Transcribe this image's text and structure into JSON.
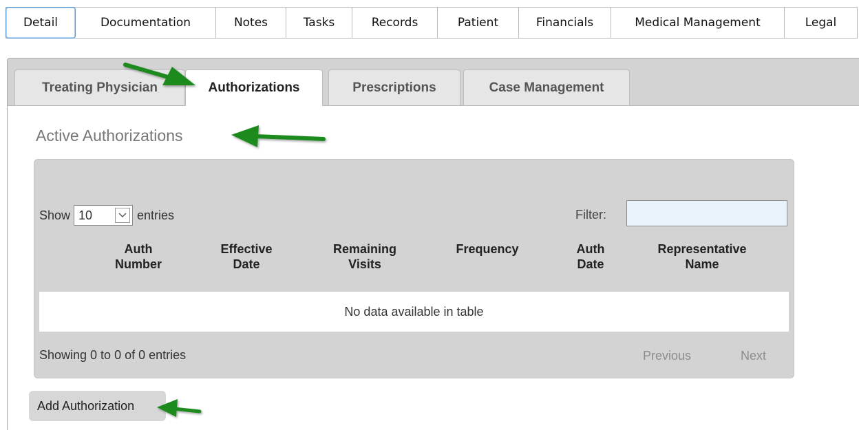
{
  "top_tabs": [
    {
      "label": "Detail",
      "active": true
    },
    {
      "label": "Documentation"
    },
    {
      "label": "Notes"
    },
    {
      "label": "Tasks"
    },
    {
      "label": "Records"
    },
    {
      "label": "Patient"
    },
    {
      "label": "Financials"
    },
    {
      "label": "Medical Management"
    },
    {
      "label": "Legal"
    }
  ],
  "sub_tabs": [
    {
      "label": "Treating Physician"
    },
    {
      "label": "Authorizations",
      "active": true
    },
    {
      "label": "Prescriptions"
    },
    {
      "label": "Case Management"
    }
  ],
  "section_title": "Active Authorizations",
  "table": {
    "show_label": "Show",
    "page_size": "10",
    "entries_label": "entries",
    "filter_label": "Filter:",
    "filter_value": "",
    "columns": [
      {
        "line1": "Auth",
        "line2": "Number"
      },
      {
        "line1": "Effective",
        "line2": "Date"
      },
      {
        "line1": "Remaining",
        "line2": "Visits"
      },
      {
        "line1": "Frequency",
        "line2": ""
      },
      {
        "line1": "Auth",
        "line2": "Date"
      },
      {
        "line1": "Representative",
        "line2": "Name"
      }
    ],
    "empty_message": "No data available in table",
    "info": "Showing 0 to 0 of 0 entries",
    "previous_label": "Previous",
    "next_label": "Next"
  },
  "add_button_label": "Add Authorization",
  "colors": {
    "annotation_arrow": "#1a8a1f",
    "active_tab_border": "#5b9bd5",
    "panel_gray": "#d3d3d3",
    "filter_bg": "#e9f1fb"
  }
}
